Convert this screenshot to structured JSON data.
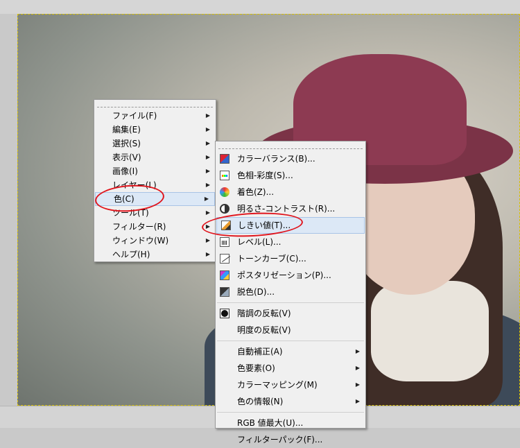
{
  "menu_main": {
    "items": [
      {
        "label": "ファイル(F)",
        "submenu": true
      },
      {
        "label": "編集(E)",
        "submenu": true
      },
      {
        "label": "選択(S)",
        "submenu": true
      },
      {
        "label": "表示(V)",
        "submenu": true
      },
      {
        "label": "画像(I)",
        "submenu": true
      },
      {
        "label": "レイヤー(L)",
        "submenu": true
      },
      {
        "label": "色(C)",
        "submenu": true,
        "highlighted": true
      },
      {
        "label": "ツール(T)",
        "submenu": true
      },
      {
        "label": "フィルター(R)",
        "submenu": true
      },
      {
        "label": "ウィンドウ(W)",
        "submenu": true
      },
      {
        "label": "ヘルプ(H)",
        "submenu": true
      }
    ]
  },
  "menu_color": {
    "items": [
      {
        "label": "カラーバランス(B)...",
        "icon": "color-balance-icon"
      },
      {
        "label": "色相-彩度(S)...",
        "icon": "hue-saturation-icon"
      },
      {
        "label": "着色(Z)...",
        "icon": "colorize-icon"
      },
      {
        "label": "明るさ-コントラスト(R)...",
        "icon": "brightness-contrast-icon"
      },
      {
        "label": "しきい値(T)...",
        "icon": "threshold-icon",
        "highlighted": true
      },
      {
        "label": "レベル(L)...",
        "icon": "levels-icon"
      },
      {
        "label": "トーンカーブ(C)...",
        "icon": "curves-icon"
      },
      {
        "label": "ポスタリゼーション(P)...",
        "icon": "posterize-icon"
      },
      {
        "label": "脱色(D)...",
        "icon": "desaturate-icon"
      },
      {
        "label": "階調の反転(V)",
        "icon": "invert-icon"
      },
      {
        "label": "明度の反転(V)"
      },
      {
        "label": "自動補正(A)",
        "submenu": true
      },
      {
        "label": "色要素(O)",
        "submenu": true
      },
      {
        "label": "カラーマッピング(M)",
        "submenu": true
      },
      {
        "label": "色の情報(N)",
        "submenu": true
      },
      {
        "label": "RGB 値最大(U)..."
      },
      {
        "label": "フィルターパック(F)..."
      }
    ]
  },
  "colors": {
    "highlight_bg": "#dce8f6",
    "annotation_circle": "#e0141c",
    "selection_marquee": "#d8c000"
  },
  "submenu_arrow": "▶"
}
